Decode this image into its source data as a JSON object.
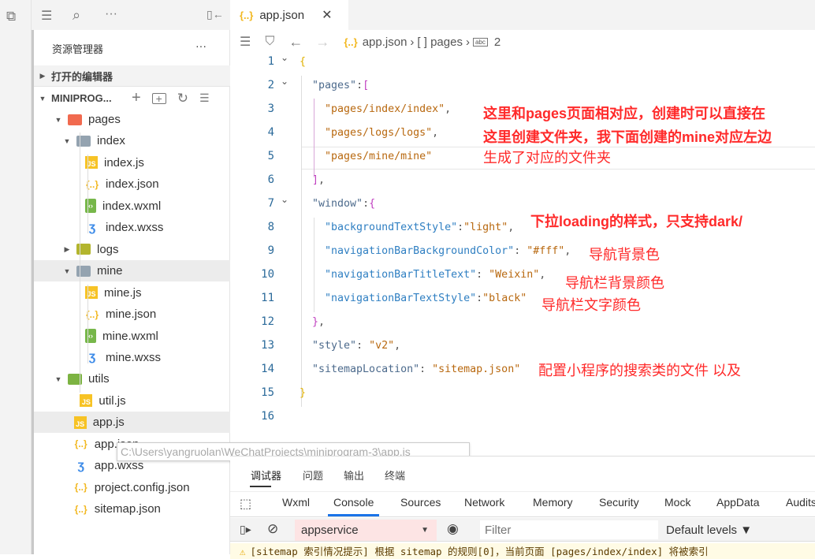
{
  "activity": {
    "icon": "window-icon"
  },
  "sidebar": {
    "toolbar": [
      "list-icon",
      "search-icon",
      "more-icon",
      "collapse-icon"
    ],
    "title": "资源管理器",
    "title_more": "···",
    "open_editors": "打开的编辑器",
    "project": "MINIPROG...",
    "tree": [
      {
        "label": "pages",
        "type": "folder-pages",
        "depth": 0,
        "open": true
      },
      {
        "label": "index",
        "type": "folder",
        "depth": 1,
        "open": true
      },
      {
        "label": "index.js",
        "type": "js",
        "depth": 2
      },
      {
        "label": "index.json",
        "type": "json",
        "depth": 2
      },
      {
        "label": "index.wxml",
        "type": "wxml",
        "depth": 2
      },
      {
        "label": "index.wxss",
        "type": "wxss",
        "depth": 2
      },
      {
        "label": "logs",
        "type": "folder-logs",
        "depth": 1,
        "open": false
      },
      {
        "label": "mine",
        "type": "folder",
        "depth": 1,
        "open": true,
        "selected": true
      },
      {
        "label": "mine.js",
        "type": "js",
        "depth": 2
      },
      {
        "label": "mine.json",
        "type": "json",
        "depth": 2
      },
      {
        "label": "mine.wxml",
        "type": "wxml",
        "depth": 2
      },
      {
        "label": "mine.wxss",
        "type": "wxss",
        "depth": 2
      },
      {
        "label": "utils",
        "type": "folder-utils",
        "depth": 0,
        "open": true
      },
      {
        "label": "util.js",
        "type": "js",
        "depth": 1.4
      },
      {
        "label": "app.js",
        "type": "js",
        "depth": 0.7,
        "selected": true
      },
      {
        "label": "app.json",
        "type": "json",
        "depth": 0.7
      },
      {
        "label": "app.wxss",
        "type": "wxss",
        "depth": 0.7
      },
      {
        "label": "project.config.json",
        "type": "json",
        "depth": 0.7
      },
      {
        "label": "sitemap.json",
        "type": "json",
        "depth": 0.7
      }
    ],
    "tooltip": "C:\\Users\\yangruolan\\WeChatProjects\\miniprogram-3\\app.js"
  },
  "editor": {
    "tab": "app.json",
    "breadcrumb": [
      "app.json",
      "[ ] pages",
      "2"
    ],
    "lines": [
      [
        [
          "y",
          "{"
        ]
      ],
      [
        [
          "k",
          "  \"pages\""
        ],
        [
          "",
          ":"
        ],
        [
          "p",
          "["
        ]
      ],
      [
        [
          "s",
          "    \"pages/index/index\""
        ],
        [
          "",
          ","
        ]
      ],
      [
        [
          "s",
          "    \"pages/logs/logs\""
        ],
        [
          "",
          ","
        ]
      ],
      [
        [
          "s",
          "    \"pages/mine/mine\""
        ]
      ],
      [
        [
          "p",
          "  ]"
        ],
        [
          "",
          ","
        ]
      ],
      [
        [
          "k",
          "  \"window\""
        ],
        [
          "",
          ":"
        ],
        [
          "p",
          "{"
        ]
      ],
      [
        [
          "k2",
          "    \"backgroundTextStyle\""
        ],
        [
          "",
          ":"
        ],
        [
          "s",
          "\"light\""
        ],
        [
          "",
          ","
        ]
      ],
      [
        [
          "k2",
          "    \"navigationBarBackgroundColor\""
        ],
        [
          "",
          ": "
        ],
        [
          "s",
          "\"#fff\""
        ],
        [
          "",
          ","
        ]
      ],
      [
        [
          "k2",
          "    \"navigationBarTitleText\""
        ],
        [
          "",
          ": "
        ],
        [
          "s",
          "\"Weixin\""
        ],
        [
          "",
          ","
        ]
      ],
      [
        [
          "k2",
          "    \"navigationBarTextStyle\""
        ],
        [
          "",
          ":"
        ],
        [
          "s",
          "\"black\""
        ]
      ],
      [
        [
          "p",
          "  }"
        ],
        [
          "",
          ","
        ]
      ],
      [
        [
          "k",
          "  \"style\""
        ],
        [
          "",
          ": "
        ],
        [
          "s",
          "\"v2\""
        ],
        [
          "",
          ","
        ]
      ],
      [
        [
          "k",
          "  \"sitemapLocation\""
        ],
        [
          "",
          ": "
        ],
        [
          "s",
          "\"sitemap.json\""
        ]
      ],
      [
        [
          "y",
          "}"
        ]
      ],
      []
    ],
    "notes": [
      "这里和pages页面相对应，创建时可以直接在",
      "这里创建文件夹，我下面创建的mine对应左边",
      "生成了对应的文件夹",
      "下拉loading的样式，只支持dark/",
      "导航背景色",
      "导航栏背景颜色",
      "导航栏文字颜色",
      "配置小程序的搜索类的文件 以及"
    ]
  },
  "panel": {
    "tabs": [
      "调试器",
      "问题",
      "输出",
      "终端"
    ],
    "devtools_tabs": [
      "Wxml",
      "Console",
      "Sources",
      "Network",
      "Memory",
      "Security",
      "Mock",
      "AppData",
      "Audits"
    ],
    "active_devtools_tab": "Console",
    "context": "appservice",
    "filter_placeholder": "Filter",
    "levels": "Default levels ▼",
    "warning": "[sitemap 索引情况提示] 根据 sitemap 的规则[0]，当前页面 [pages/index/index] 将被索引"
  },
  "colors": {
    "accent": "#1a73e8",
    "annotation": "#ff2a2a",
    "string": "#b8680f",
    "key": "#2f7fc2"
  }
}
